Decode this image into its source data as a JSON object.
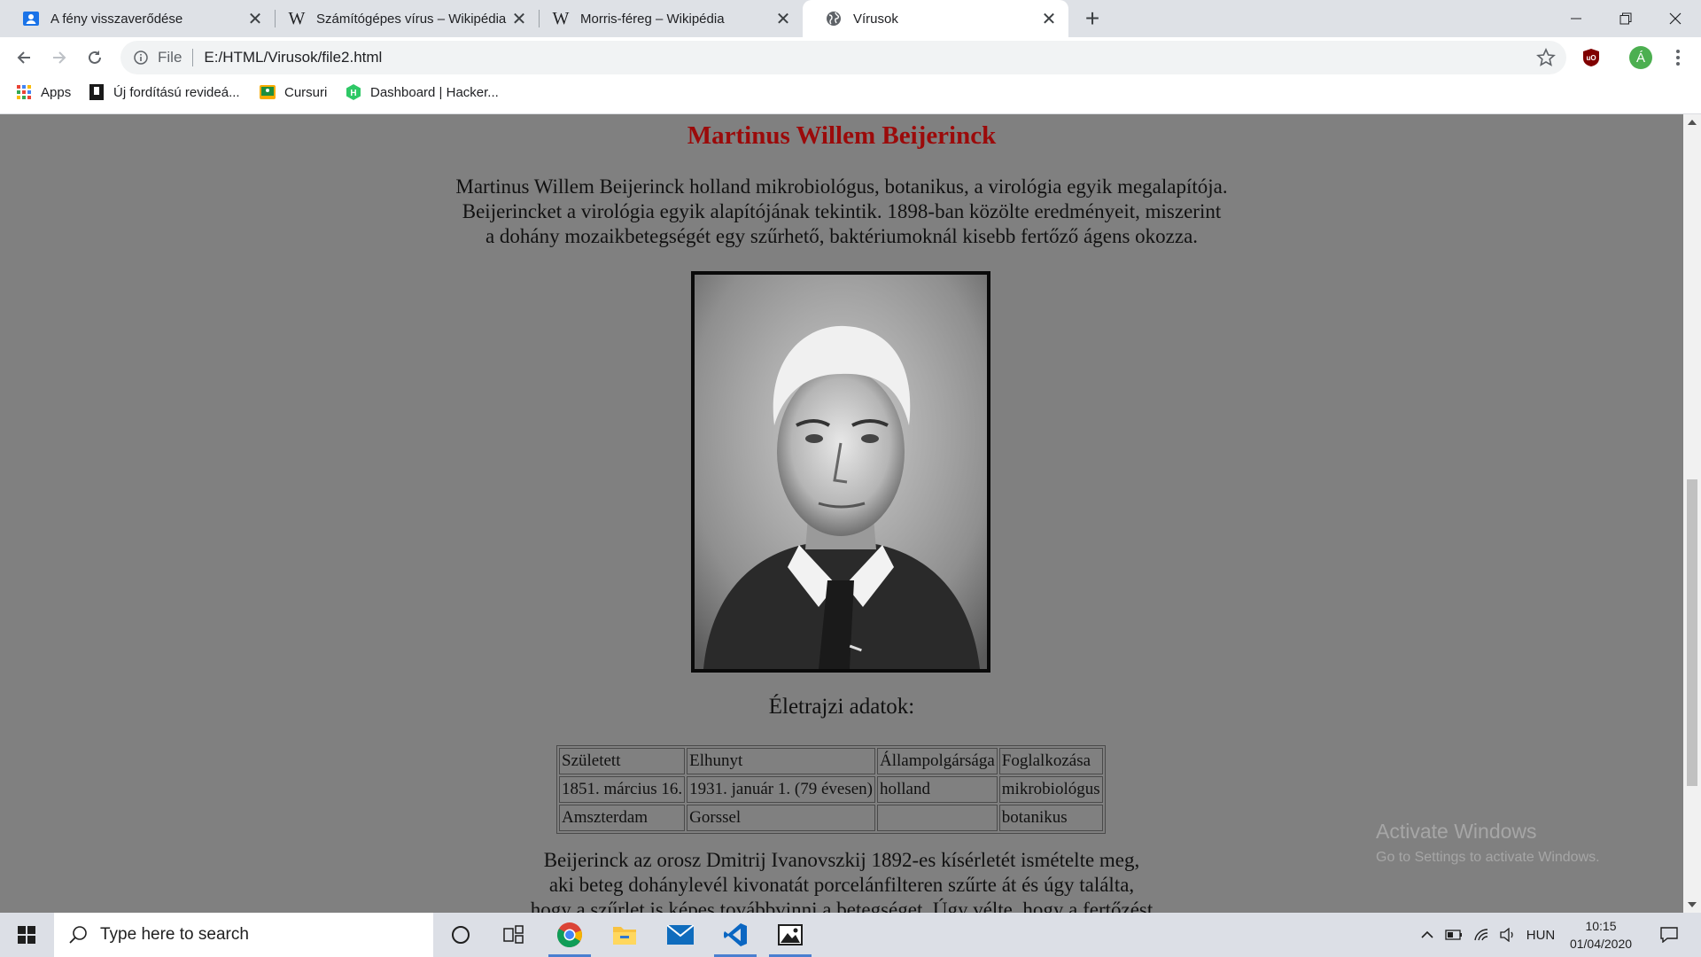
{
  "browser": {
    "tabs": [
      {
        "title": "A fény visszaverődése",
        "favicon": "classroom-icon",
        "active": false
      },
      {
        "title": "Számítógépes vírus – Wikipédia",
        "favicon": "wikipedia-icon",
        "active": false
      },
      {
        "title": "Morris-féreg – Wikipédia",
        "favicon": "wikipedia-icon",
        "active": false
      },
      {
        "title": "Vírusok",
        "favicon": "globe-icon",
        "active": true
      }
    ],
    "address": {
      "scheme": "File",
      "url": "E:/HTML/Virusok/file2.html"
    },
    "profile_initial": "Á",
    "bookmarks": [
      {
        "label": "Apps",
        "icon": "apps-grid-icon"
      },
      {
        "label": "Új fordítású revideá...",
        "icon": "bible-icon"
      },
      {
        "label": "Cursuri",
        "icon": "classroom-icon"
      },
      {
        "label": "Dashboard | Hacker...",
        "icon": "hackerrank-icon"
      }
    ]
  },
  "page": {
    "heading": "Martinus Willem Beijerinck",
    "intro": [
      "Martinus Willem Beijerinck holland mikrobiológus, botanikus, a virológia egyik megalapítója.",
      "Beijerincket a virológia egyik alapítójának tekintik. 1898-ban közölte eredményeit, miszerint",
      "a dohány mozaikbetegségét egy szűrhető, baktériumoknál kisebb fertőző ágens okozza."
    ],
    "bio_heading": "Életrajzi adatok:",
    "bio_table": {
      "rows": [
        [
          "Született",
          "Elhunyt",
          "Állampolgársága",
          "Foglalkozása"
        ],
        [
          "1851. március 16.",
          "1931. január 1. (79 évesen)",
          "holland",
          "mikrobiológus"
        ],
        [
          "Amszterdam",
          "Gorssel",
          "",
          "botanikus"
        ]
      ]
    },
    "outro": [
      "Beijerinck az orosz Dmitrij Ivanovszkij 1892-es kísérletét ismételte meg,",
      "aki beteg dohánylevél kivonatát porcelánfilteren szűrte át és úgy találta,",
      "hogy a szűrlet is képes továbbvinni a betegséget. Úgy vélte, hogy a fertőzést"
    ]
  },
  "watermark": {
    "title": "Activate Windows",
    "subtitle": "Go to Settings to activate Windows."
  },
  "taskbar": {
    "search_placeholder": "Type here to search",
    "apps": [
      "chrome-icon",
      "file-explorer-icon",
      "mail-icon",
      "vscode-icon",
      "photos-icon"
    ],
    "language": "HUN",
    "time": "10:15",
    "date": "01/04/2020"
  }
}
